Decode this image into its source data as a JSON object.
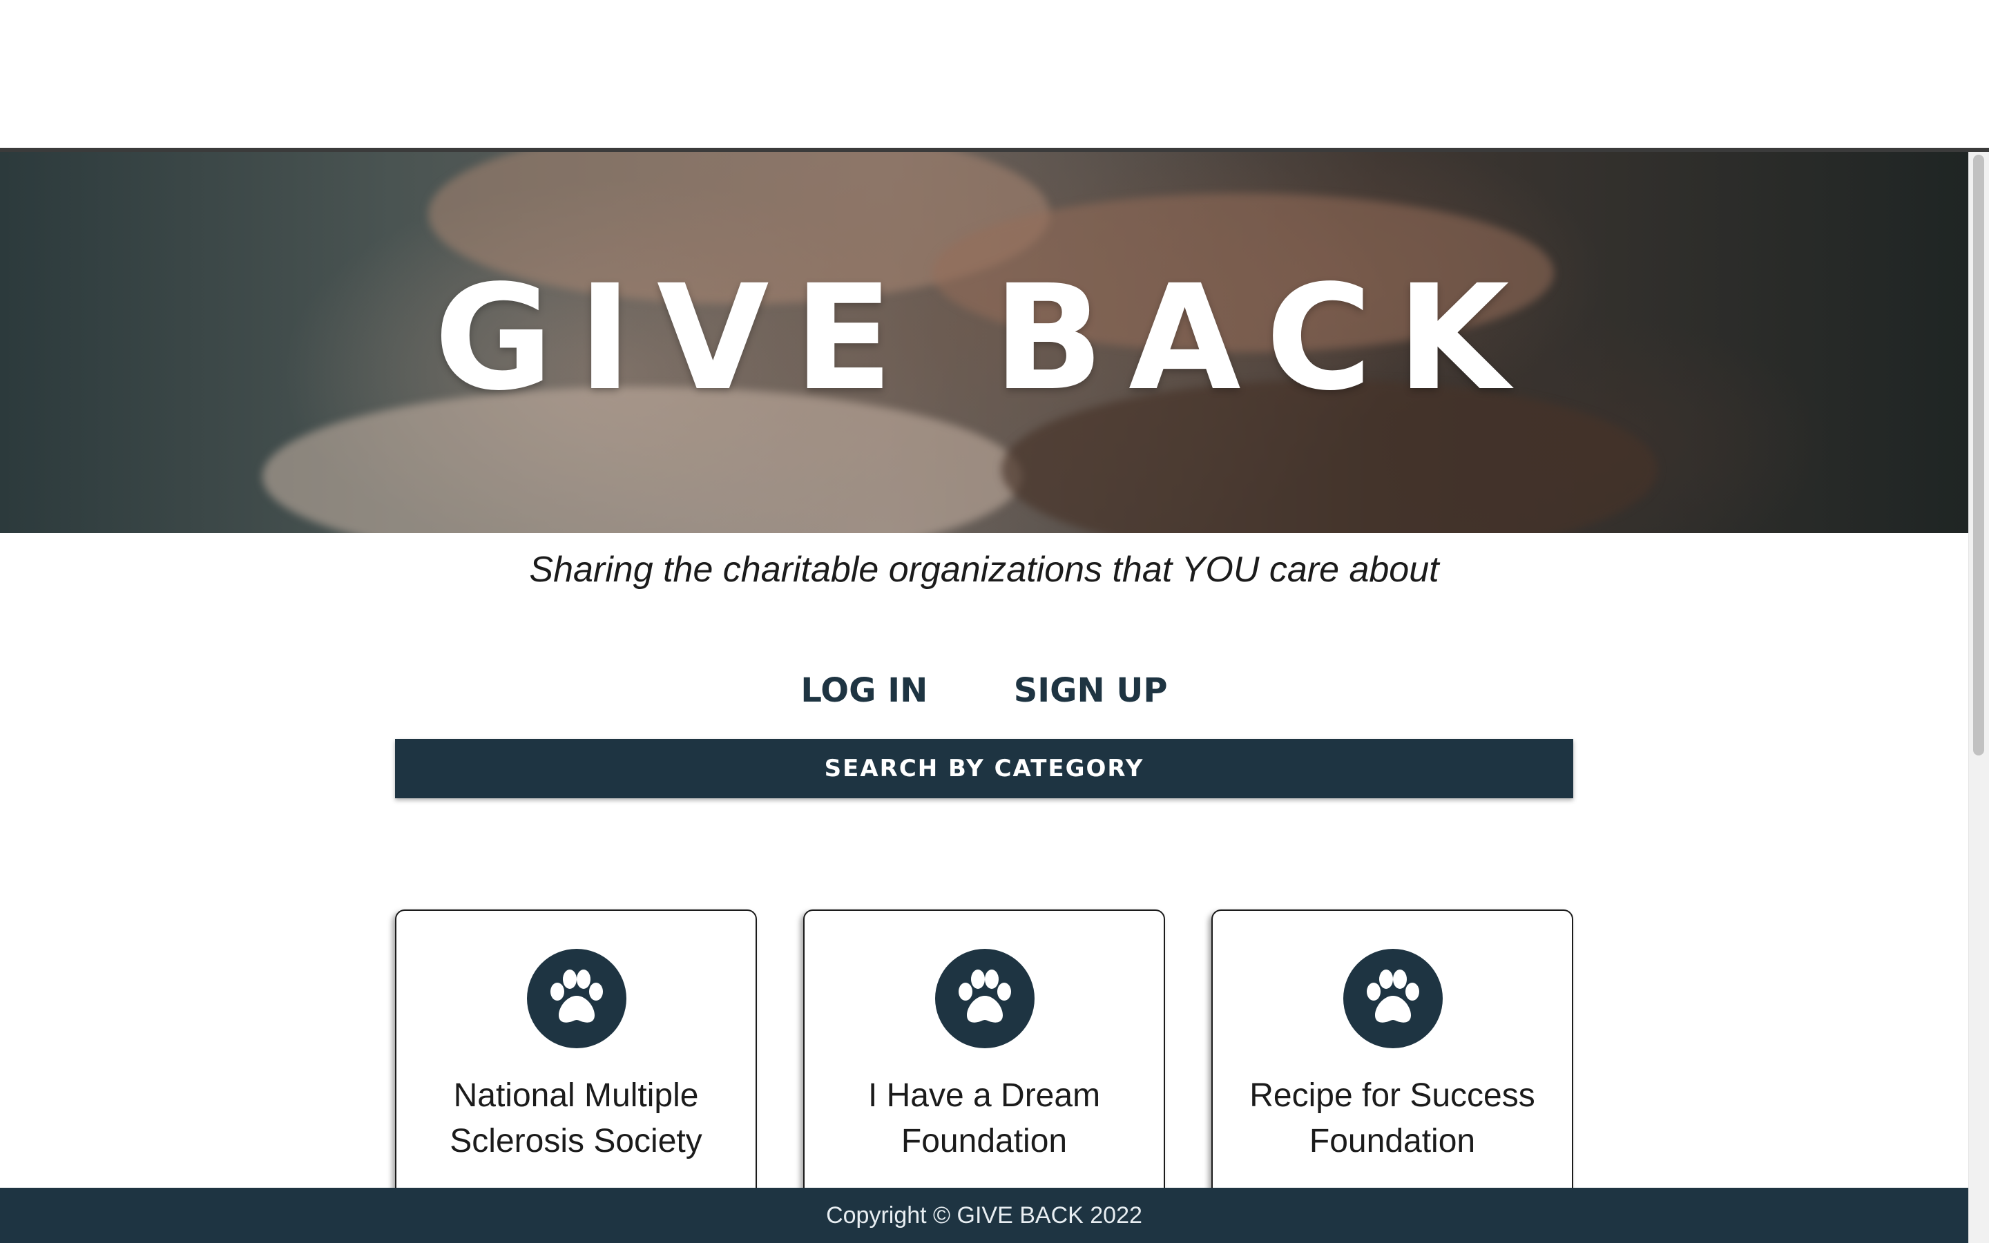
{
  "hero": {
    "title": "GIVE BACK"
  },
  "tagline": "Sharing the charitable organizations that YOU care about",
  "auth": {
    "login_label": "LOG IN",
    "signup_label": "SIGN UP"
  },
  "search": {
    "label": "SEARCH BY CATEGORY"
  },
  "cards": [
    {
      "icon": "paw-icon",
      "name_line1": "National Multiple",
      "name_line2": "Sclerosis Society"
    },
    {
      "icon": "paw-icon",
      "name_line1": "I Have a Dream",
      "name_line2": "Foundation"
    },
    {
      "icon": "paw-icon",
      "name_line1": "Recipe for Success",
      "name_line2": "Foundation"
    }
  ],
  "footer": {
    "copyright": "Copyright © GIVE BACK 2022"
  },
  "colors": {
    "brand": "#1e3442",
    "text": "#1b1b1b",
    "background": "#ffffff"
  }
}
